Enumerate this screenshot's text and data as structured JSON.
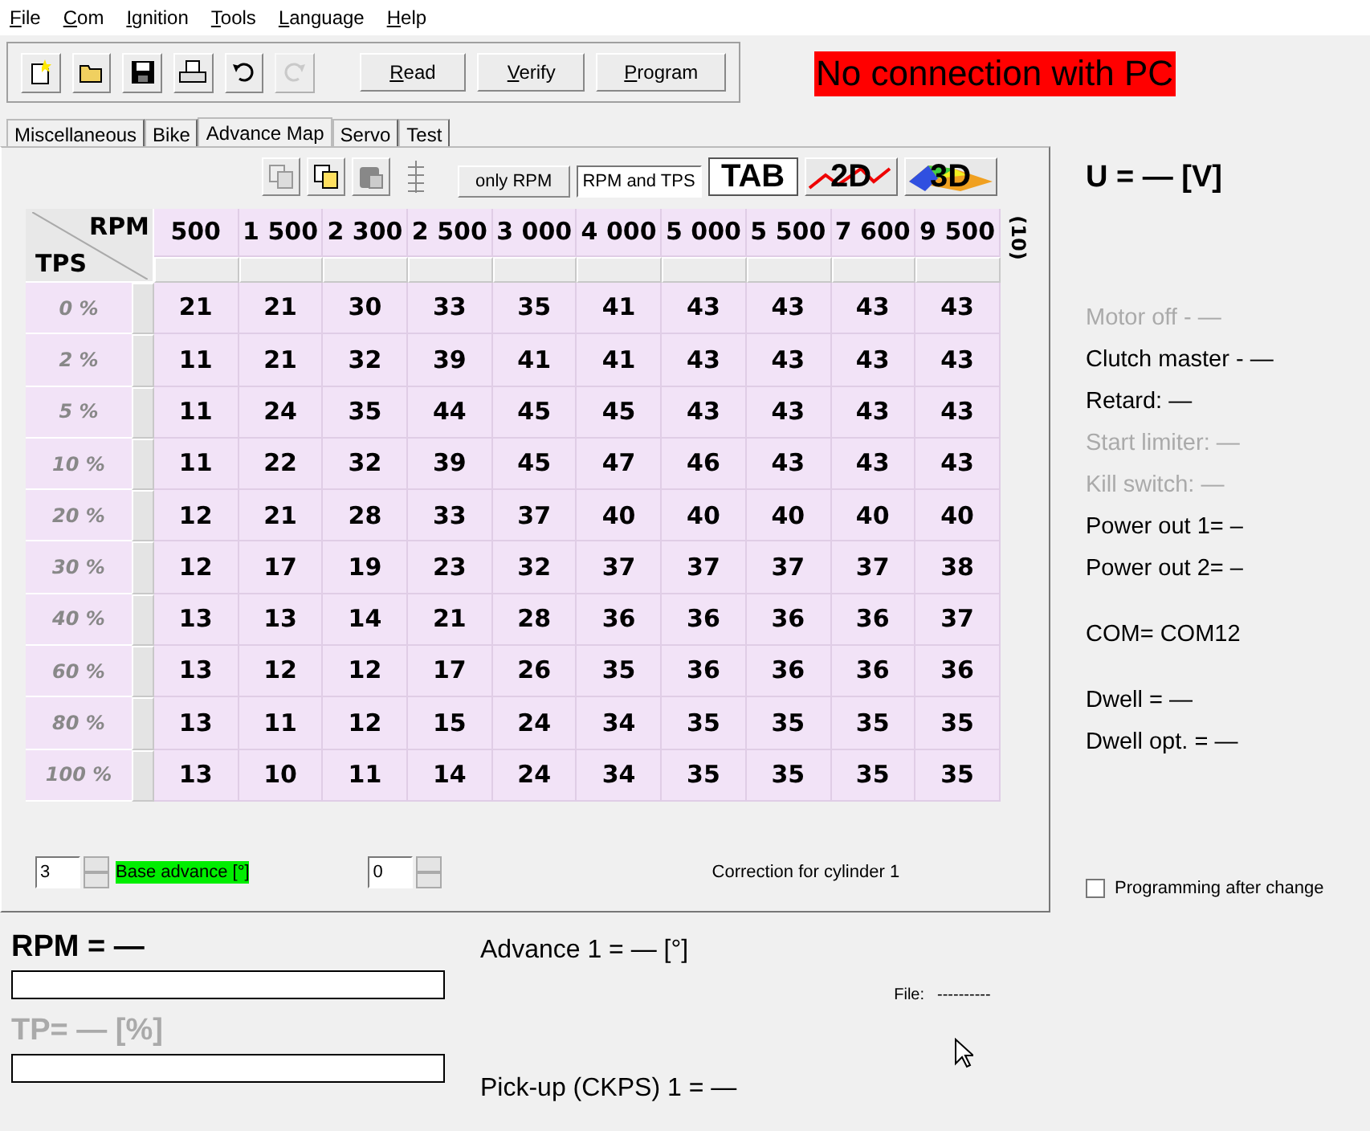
{
  "menu": [
    "File",
    "Com",
    "Ignition",
    "Tools",
    "Language",
    "Help"
  ],
  "toolbar": {
    "icons": [
      {
        "kind": "new",
        "disabled": false
      },
      {
        "kind": "open",
        "disabled": false
      },
      {
        "kind": "save",
        "disabled": false
      },
      {
        "kind": "print",
        "disabled": false
      },
      {
        "kind": "undo",
        "disabled": false
      },
      {
        "kind": "redo",
        "disabled": true
      }
    ],
    "buttons": [
      "Read",
      "Verify",
      "Program"
    ]
  },
  "connection_status": "No connection with PC",
  "tabs": [
    {
      "label": "Miscellaneous",
      "selected": false
    },
    {
      "label": "Bike",
      "selected": false
    },
    {
      "label": "Advance Map",
      "selected": true
    },
    {
      "label": "Servo",
      "selected": false
    },
    {
      "label": "Test",
      "selected": false
    }
  ],
  "map_toolbar": {
    "icons": [
      {
        "kind": "copy"
      },
      {
        "kind": "copy-table"
      },
      {
        "kind": "paste"
      },
      {
        "kind": "adjust"
      }
    ],
    "modes": [
      {
        "label": "only RPM",
        "selected": false
      },
      {
        "label": "RPM and TPS",
        "selected": true
      }
    ],
    "views": [
      {
        "kind": "table",
        "label": "TAB",
        "selected": true
      },
      {
        "kind": "line",
        "label": "2D",
        "selected": false
      },
      {
        "kind": "surface",
        "label": "3D",
        "selected": false
      }
    ]
  },
  "table": {
    "corner_top": "RPM",
    "corner_bottom": "TPS",
    "side_label": "(10)",
    "columns": [
      "500",
      "1 500",
      "2 300",
      "2 500",
      "3 000",
      "4 000",
      "5 000",
      "5 500",
      "7 600",
      "9 500"
    ],
    "rows": [
      {
        "label": "0 %",
        "values": [
          "21",
          "21",
          "30",
          "33",
          "35",
          "41",
          "43",
          "43",
          "43",
          "43"
        ]
      },
      {
        "label": "2 %",
        "values": [
          "11",
          "21",
          "32",
          "39",
          "41",
          "41",
          "43",
          "43",
          "43",
          "43"
        ]
      },
      {
        "label": "5 %",
        "values": [
          "11",
          "24",
          "35",
          "44",
          "45",
          "45",
          "43",
          "43",
          "43",
          "43"
        ]
      },
      {
        "label": "10 %",
        "values": [
          "11",
          "22",
          "32",
          "39",
          "45",
          "47",
          "46",
          "43",
          "43",
          "43"
        ]
      },
      {
        "label": "20 %",
        "values": [
          "12",
          "21",
          "28",
          "33",
          "37",
          "40",
          "40",
          "40",
          "40",
          "40"
        ]
      },
      {
        "label": "30 %",
        "values": [
          "12",
          "17",
          "19",
          "23",
          "32",
          "37",
          "37",
          "37",
          "37",
          "38"
        ]
      },
      {
        "label": "40 %",
        "values": [
          "13",
          "13",
          "14",
          "21",
          "28",
          "36",
          "36",
          "36",
          "36",
          "37"
        ]
      },
      {
        "label": "60 %",
        "values": [
          "13",
          "12",
          "12",
          "17",
          "26",
          "35",
          "36",
          "36",
          "36",
          "36"
        ]
      },
      {
        "label": "80 %",
        "values": [
          "13",
          "11",
          "12",
          "15",
          "24",
          "34",
          "35",
          "35",
          "35",
          "35"
        ]
      },
      {
        "label": "100 %",
        "values": [
          "13",
          "10",
          "11",
          "14",
          "24",
          "34",
          "35",
          "35",
          "35",
          "35"
        ]
      }
    ]
  },
  "base_advance": {
    "value": "3",
    "label": "Base advance [°]"
  },
  "cylinder_correction": {
    "value": "0",
    "label": "Correction for cylinder 1"
  },
  "voltage": "U = — [V]",
  "status_groups": [
    [
      {
        "text": "Motor off - —",
        "disabled": true
      },
      {
        "text": "Clutch master - —",
        "disabled": false
      },
      {
        "text": "Retard: —",
        "disabled": false
      },
      {
        "text": "Start limiter: —",
        "disabled": true
      },
      {
        "text": "Kill switch: —",
        "disabled": true
      },
      {
        "text": "Power out 1= –",
        "disabled": false
      },
      {
        "text": "Power out 2= –",
        "disabled": false
      }
    ],
    [
      {
        "text": "COM= COM12",
        "disabled": false
      }
    ],
    [
      {
        "text": "Dwell = —",
        "disabled": false
      },
      {
        "text": "Dwell opt. = —",
        "disabled": false
      }
    ]
  ],
  "programming_after_change": {
    "label": "Programming after change",
    "checked": false
  },
  "rpm": {
    "label": "RPM = —",
    "disabled": false,
    "level": 0
  },
  "tp": {
    "label": "TP= — [%]",
    "disabled": true,
    "level": 0
  },
  "advance": "Advance 1 = — [°]",
  "pickup": "Pick-up (CKPS) 1 = —",
  "file": {
    "label": "File:",
    "value": "----------"
  }
}
